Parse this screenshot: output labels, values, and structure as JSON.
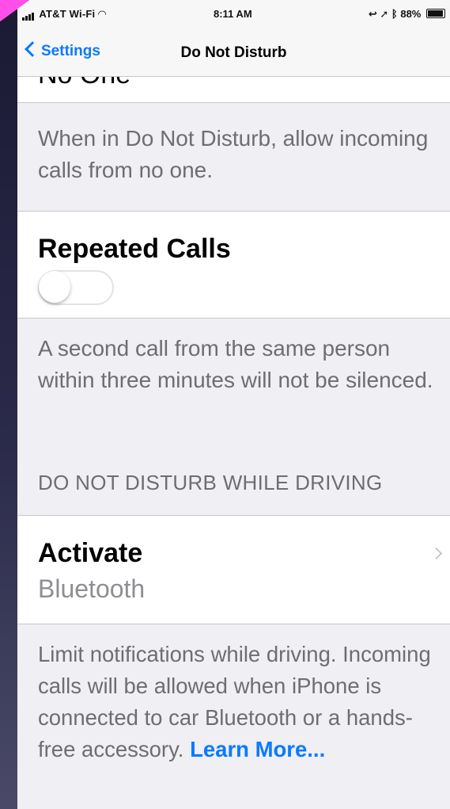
{
  "status_bar": {
    "carrier": "AT&T Wi-Fi",
    "time": "8:11 AM",
    "battery": "88%",
    "battery_level": 0.88
  },
  "nav": {
    "back_label": "Settings",
    "title": "Do Not Disturb"
  },
  "partial_row": {
    "label": "No One"
  },
  "calls_footer": "When in Do Not Disturb, allow incoming calls from no one.",
  "repeated_calls": {
    "label": "Repeated Calls",
    "enabled": false,
    "footer": "A second call from the same person within three minutes will not be silenced."
  },
  "driving": {
    "header": "DO NOT DISTURB WHILE DRIVING",
    "activate_label": "Activate",
    "activate_value": "Bluetooth",
    "footer": "Limit notifications while driving. Incoming calls will be allowed when iPhone is connected to car Bluetooth or a hands-free accessory.",
    "learn_more": "Learn More..."
  },
  "colors": {
    "accent": "#0a7aff",
    "annotation_stripe": "#ff4fe8"
  }
}
